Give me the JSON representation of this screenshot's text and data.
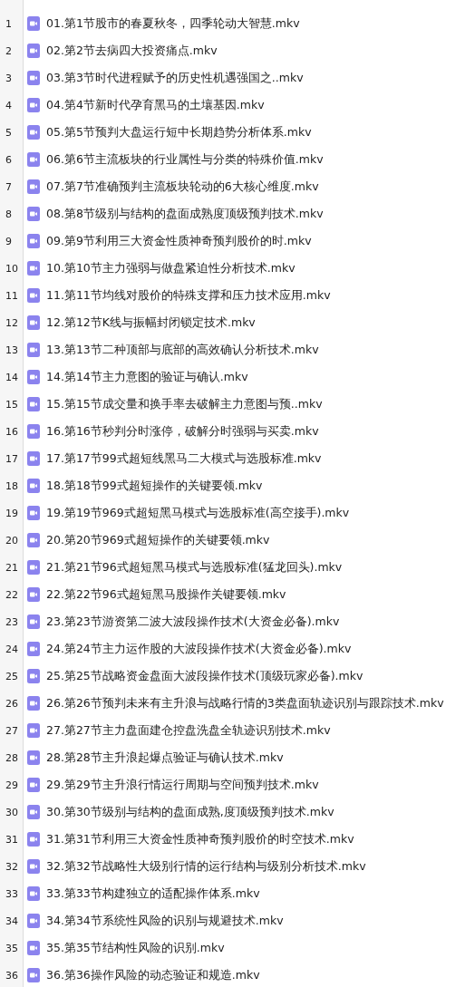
{
  "files": [
    {
      "row": "1",
      "name": "01.第1节股市的春夏秋冬，四季轮动大智慧.mkv"
    },
    {
      "row": "2",
      "name": "02.第2节去病四大投资痛点.mkv"
    },
    {
      "row": "3",
      "name": "03.第3节时代进程赋予的历史性机遇强国之..mkv"
    },
    {
      "row": "4",
      "name": "04.第4节新时代孕育黑马的土壤基因.mkv"
    },
    {
      "row": "5",
      "name": "05.第5节预判大盘运行短中长期趋势分析体系.mkv"
    },
    {
      "row": "6",
      "name": "06.第6节主流板块的行业属性与分类的特殊价值.mkv"
    },
    {
      "row": "7",
      "name": "07.第7节准确预判主流板块轮动的6大核心维度.mkv"
    },
    {
      "row": "8",
      "name": "08.第8节级别与结构的盘面成熟度顶级预判技术.mkv"
    },
    {
      "row": "9",
      "name": "09.第9节利用三大资金性质神奇预判股价的时.mkv"
    },
    {
      "row": "10",
      "name": "10.第10节主力强弱与做盘紧迫性分析技术.mkv"
    },
    {
      "row": "11",
      "name": "11.第11节均线对股价的特殊支撑和压力技术应用.mkv"
    },
    {
      "row": "12",
      "name": "12.第12节K线与振幅封闭锁定技术.mkv"
    },
    {
      "row": "13",
      "name": "13.第13节二种顶部与底部的高效确认分析技术.mkv"
    },
    {
      "row": "14",
      "name": "14.第14节主力意图的验证与确认.mkv"
    },
    {
      "row": "15",
      "name": "15.第15节成交量和换手率去破解主力意图与预..mkv"
    },
    {
      "row": "16",
      "name": "16.第16节秒判分时涨停，破解分时强弱与买卖.mkv"
    },
    {
      "row": "17",
      "name": "17.第17节99式超短线黑马二大模式与选股标准.mkv"
    },
    {
      "row": "18",
      "name": "18.第18节99式超短操作的关键要领.mkv"
    },
    {
      "row": "19",
      "name": "19.第19节969式超短黑马模式与选股标准(高空接手).mkv"
    },
    {
      "row": "20",
      "name": "20.第20节969式超短操作的关键要领.mkv"
    },
    {
      "row": "21",
      "name": "21.第21节96式超短黑马模式与选股标准(猛龙回头).mkv"
    },
    {
      "row": "22",
      "name": "22.第22节96式超短黑马股操作关键要领.mkv"
    },
    {
      "row": "23",
      "name": "23.第23节游资第二波大波段操作技术(大资金必备).mkv"
    },
    {
      "row": "24",
      "name": "24.第24节主力运作股的大波段操作技术(大资金必备).mkv"
    },
    {
      "row": "25",
      "name": "25.第25节战略资金盘面大波段操作技术(顶级玩家必备).mkv"
    },
    {
      "row": "26",
      "name": "26.第26节预判未来有主升浪与战略行情的3类盘面轨迹识别与跟踪技术.mkv"
    },
    {
      "row": "27",
      "name": "27.第27节主力盘面建仓控盘洗盘全轨迹识别技术.mkv"
    },
    {
      "row": "28",
      "name": "28.第28节主升浪起爆点验证与确认技术.mkv"
    },
    {
      "row": "29",
      "name": "29.第29节主升浪行情运行周期与空间预判技术.mkv"
    },
    {
      "row": "30",
      "name": "30.第30节级别与结构的盘面成熟,度顶级预判技术.mkv"
    },
    {
      "row": "31",
      "name": "31.第31节利用三大资金性质神奇预判股价的时空技术.mkv"
    },
    {
      "row": "32",
      "name": "32.第32节战略性大级别行情的运行结构与级别分析技术.mkv"
    },
    {
      "row": "33",
      "name": "33.第33节构建独立的适配操作体系.mkv"
    },
    {
      "row": "34",
      "name": "34.第34节系统性风险的识别与规避技术.mkv"
    },
    {
      "row": "35",
      "name": "35.第35节结构性风险的识别.mkv"
    },
    {
      "row": "36",
      "name": "36.第36操作风险的动态验证和规造.mkv"
    }
  ]
}
